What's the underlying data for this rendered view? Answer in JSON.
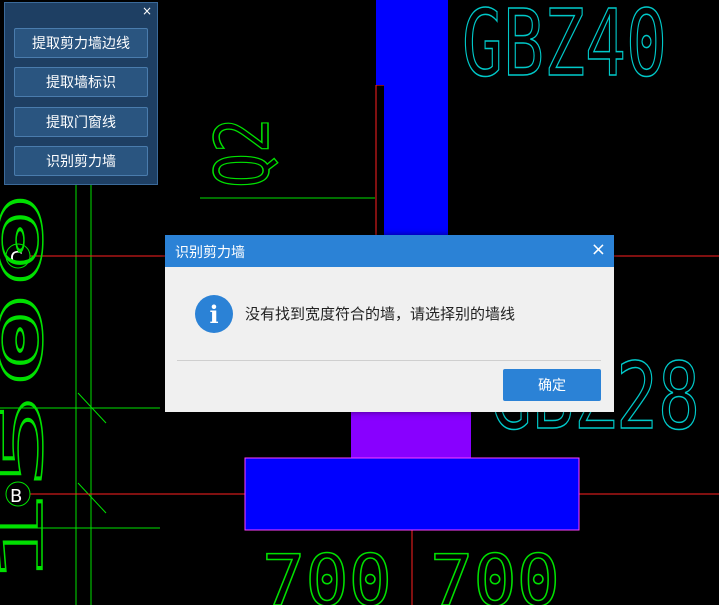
{
  "colors": {
    "background": "#000000",
    "axis_red": "#ff2020",
    "grid_green": "#00e000",
    "text_cyan": "#00c8c8",
    "wall_blue": "#0000ff",
    "wall_purple": "#8800ff",
    "dialog_accent": "#2b82d6"
  },
  "tool_panel": {
    "close_icon": "close-icon",
    "buttons": [
      {
        "label": "提取剪力墙边线"
      },
      {
        "label": "提取墙标识"
      },
      {
        "label": "提取门窗线"
      },
      {
        "label": "识别剪力墙"
      }
    ]
  },
  "cad": {
    "labels": {
      "gbz40": "GBZ40",
      "gbz28": "GBZ28",
      "q2": "Q2",
      "axis_c": "C",
      "axis_b": "B",
      "dim_left": "700",
      "dim_right": "700",
      "side_number": "1500"
    }
  },
  "dialog": {
    "title": "识别剪力墙",
    "close_symbol": "×",
    "icon": "info-icon",
    "icon_glyph": "i",
    "message": "没有找到宽度符合的墙，请选择别的墙线",
    "ok_label": "确定"
  }
}
